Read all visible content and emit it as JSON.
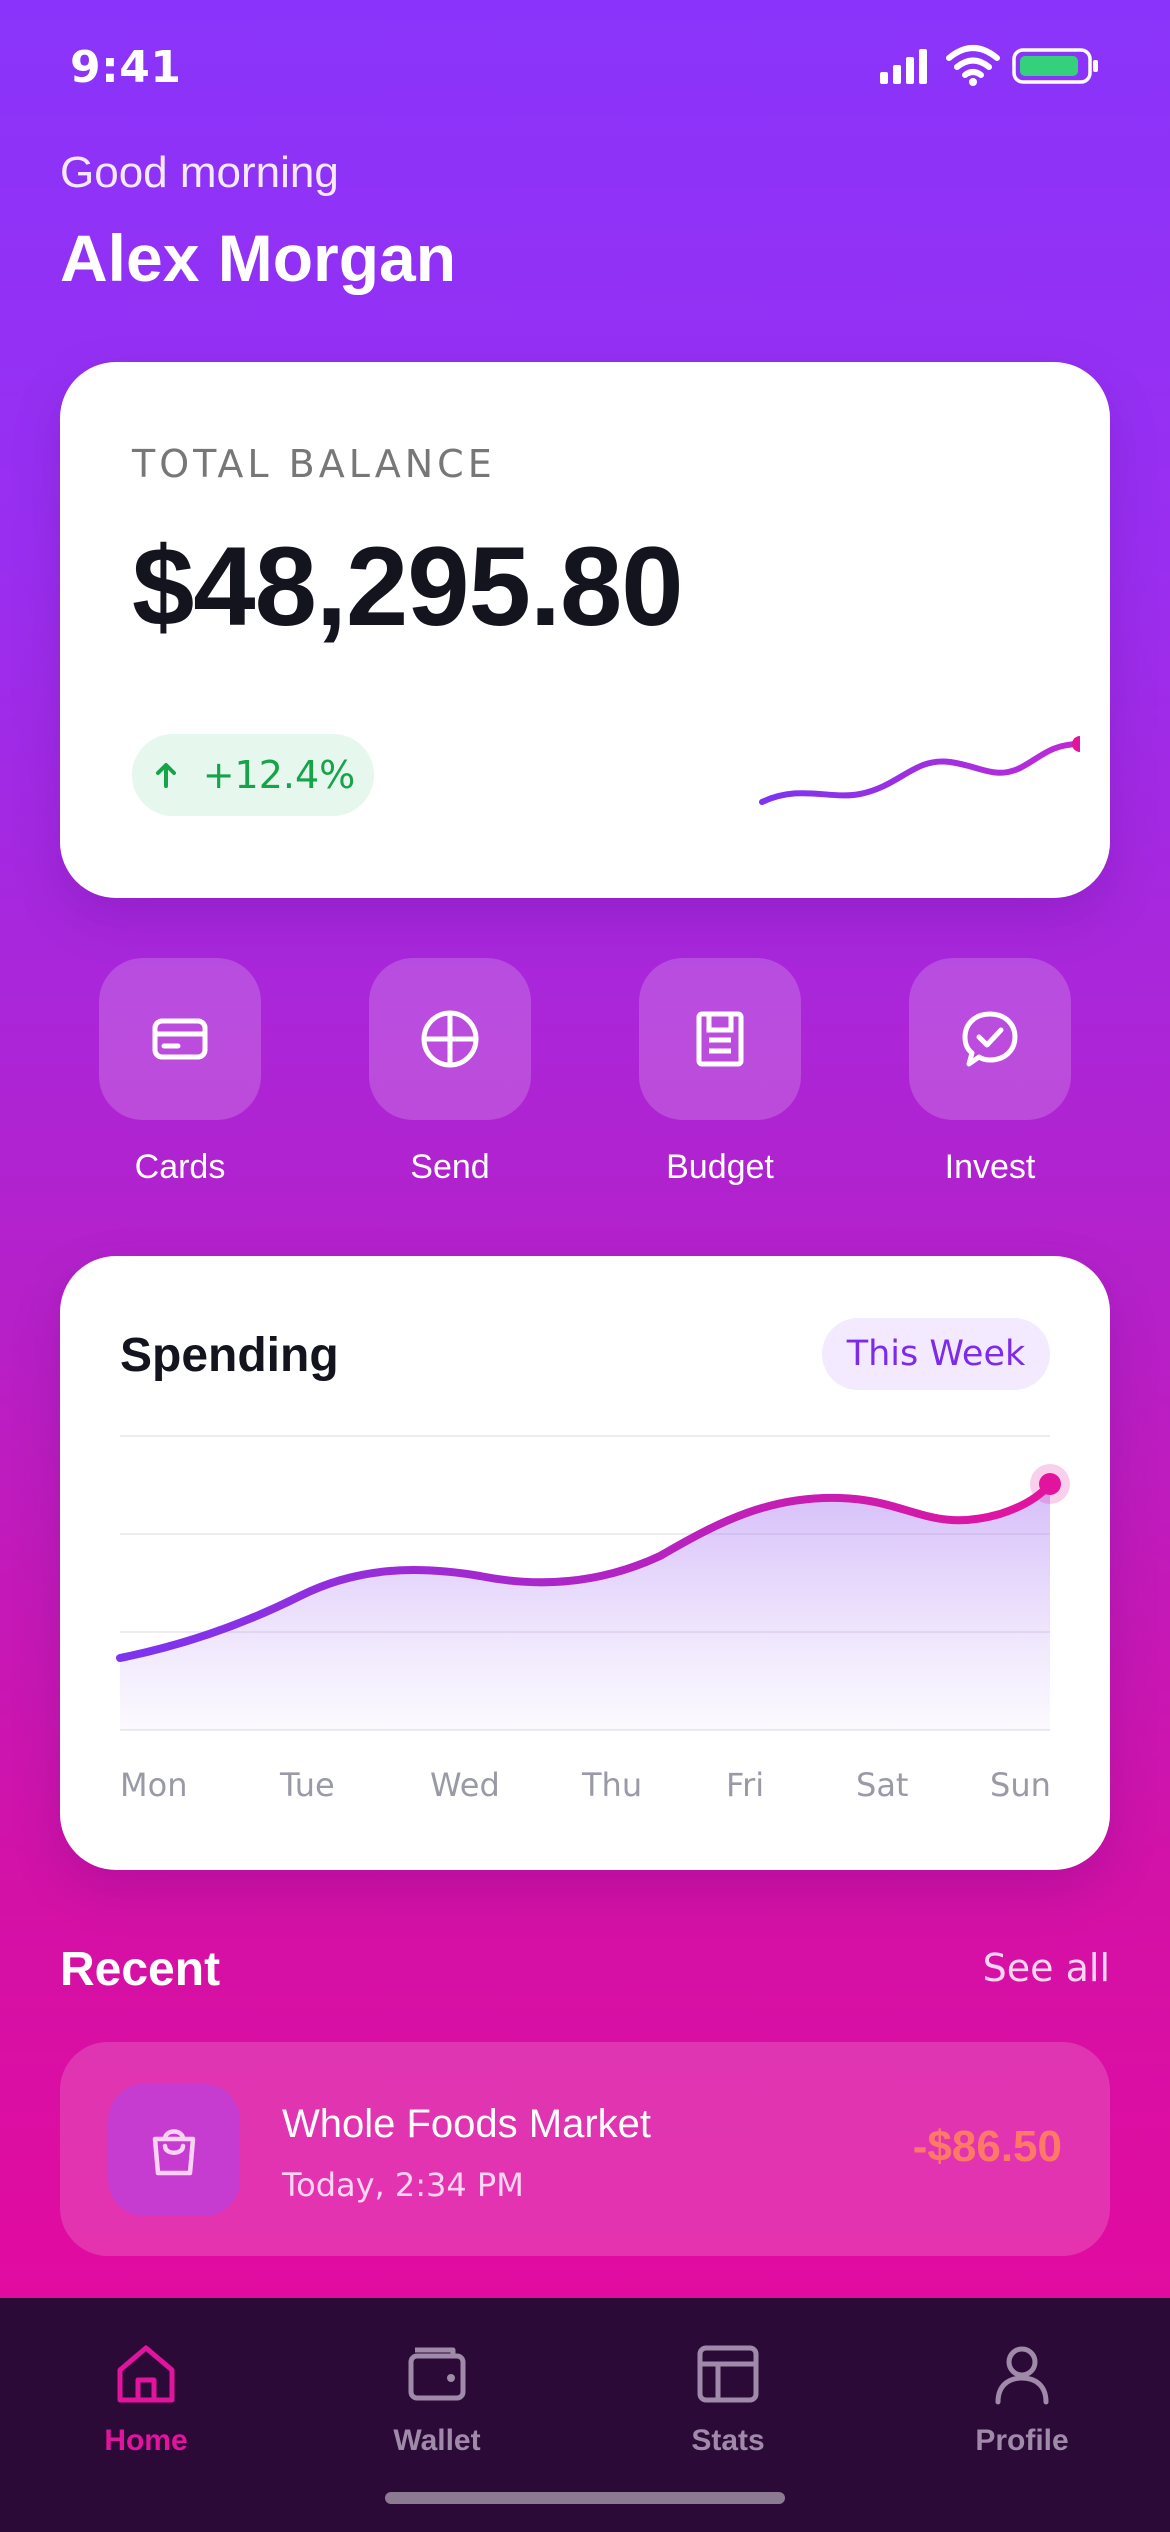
{
  "status_bar": {
    "time": "9:41"
  },
  "header": {
    "greeting": "Good morning",
    "user_name": "Alex Morgan"
  },
  "balance_card": {
    "label": "TOTAL BALANCE",
    "amount": "$48,295.80",
    "change": "+12.4%",
    "change_color": "#17a34a"
  },
  "quick_actions": [
    {
      "label": "Cards",
      "icon": "card-icon"
    },
    {
      "label": "Send",
      "icon": "globe-icon"
    },
    {
      "label": "Budget",
      "icon": "document-icon"
    },
    {
      "label": "Invest",
      "icon": "chat-check-icon"
    }
  ],
  "spending": {
    "title": "Spending",
    "period": "This Week",
    "days": [
      "Mon",
      "Tue",
      "Wed",
      "Thu",
      "Fri",
      "Sat",
      "Sun"
    ]
  },
  "recent": {
    "title": "Recent",
    "see_all": "See all",
    "transactions": [
      {
        "name": "Whole Foods Market",
        "time": "Today, 2:34 PM",
        "amount": "-$86.50",
        "icon": "shopping-bag-icon"
      }
    ]
  },
  "tab_bar": {
    "tabs": [
      {
        "label": "Home",
        "icon": "home-icon",
        "active": true
      },
      {
        "label": "Wallet",
        "icon": "wallet-icon",
        "active": false
      },
      {
        "label": "Stats",
        "icon": "stats-icon",
        "active": false
      },
      {
        "label": "Profile",
        "icon": "profile-icon",
        "active": false
      }
    ]
  },
  "colors": {
    "accent_purple": "#8a34fb",
    "accent_pink": "#e2149d",
    "negative_amount": "#ff7a66"
  }
}
